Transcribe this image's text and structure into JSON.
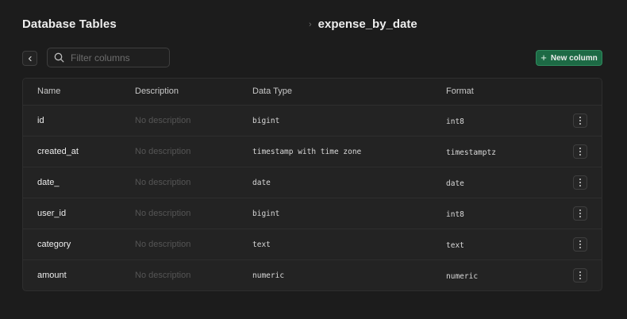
{
  "header": {
    "title": "Database Tables",
    "breadcrumb_separator": "›",
    "table_name": "expense_by_date"
  },
  "toolbar": {
    "search_placeholder": "Filter columns",
    "new_column_label": "New column"
  },
  "table": {
    "columns": [
      "Name",
      "Description",
      "Data Type",
      "Format"
    ],
    "rows": [
      {
        "name": "id",
        "description": "No description",
        "data_type": "bigint",
        "format": "int8"
      },
      {
        "name": "created_at",
        "description": "No description",
        "data_type": "timestamp with time zone",
        "format": "timestamptz"
      },
      {
        "name": "date_",
        "description": "No description",
        "data_type": "date",
        "format": "date"
      },
      {
        "name": "user_id",
        "description": "No description",
        "data_type": "bigint",
        "format": "int8"
      },
      {
        "name": "category",
        "description": "No description",
        "data_type": "text",
        "format": "text"
      },
      {
        "name": "amount",
        "description": "No description",
        "data_type": "numeric",
        "format": "numeric"
      }
    ]
  },
  "colors": {
    "background": "#1c1c1c",
    "accent": "#1d6a45",
    "border": "#2e2e2e"
  },
  "icons": {
    "back": "chevron-left-icon",
    "search": "search-icon",
    "add": "plus-icon",
    "row_menu": "more-vertical-icon"
  }
}
